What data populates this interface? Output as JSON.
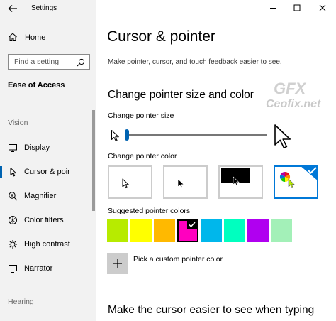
{
  "app": {
    "title": "Settings"
  },
  "sidebar": {
    "home_label": "Home",
    "search_placeholder": "Find a setting",
    "section_title": "Ease of Access",
    "groups": [
      {
        "label": "Vision"
      },
      {
        "label": "Hearing"
      }
    ],
    "items": [
      {
        "label": "Display",
        "icon": "monitor-icon",
        "active": false
      },
      {
        "label": "Cursor & poir",
        "icon": "cursor-icon",
        "active": true
      },
      {
        "label": "Magnifier",
        "icon": "magnifier-icon",
        "active": false
      },
      {
        "label": "Color filters",
        "icon": "color-filter-icon",
        "active": false
      },
      {
        "label": "High contrast",
        "icon": "contrast-icon",
        "active": false
      },
      {
        "label": "Narrator",
        "icon": "narrator-icon",
        "active": false
      }
    ]
  },
  "main": {
    "title": "Cursor & pointer",
    "subtitle": "Make pointer, cursor, and touch feedback easier to see.",
    "section_size_color": "Change pointer size and color",
    "pointer_size_label": "Change pointer size",
    "pointer_size_value": 1,
    "pointer_color_label": "Change pointer color",
    "pointer_color_options": [
      {
        "name": "white",
        "selected": false
      },
      {
        "name": "black",
        "selected": false
      },
      {
        "name": "inverted",
        "selected": false
      },
      {
        "name": "custom",
        "selected": true
      }
    ],
    "suggested_label": "Suggested pointer colors",
    "suggested_colors": [
      "#b7eb00",
      "#ffff00",
      "#ffb900",
      "#ff00bf",
      "#00b7eb",
      "#00ffbf",
      "#b000f0",
      "#a3f0b8"
    ],
    "suggested_selected_index": 3,
    "custom_color_label": "Pick a custom pointer color",
    "section_typing": "Make the cursor easier to see when typing"
  },
  "watermark": {
    "logo": "GFX",
    "text": "Ceofix.net"
  },
  "colors": {
    "accent": "#0078d7",
    "sidebar_bg": "#f2f2f2"
  }
}
